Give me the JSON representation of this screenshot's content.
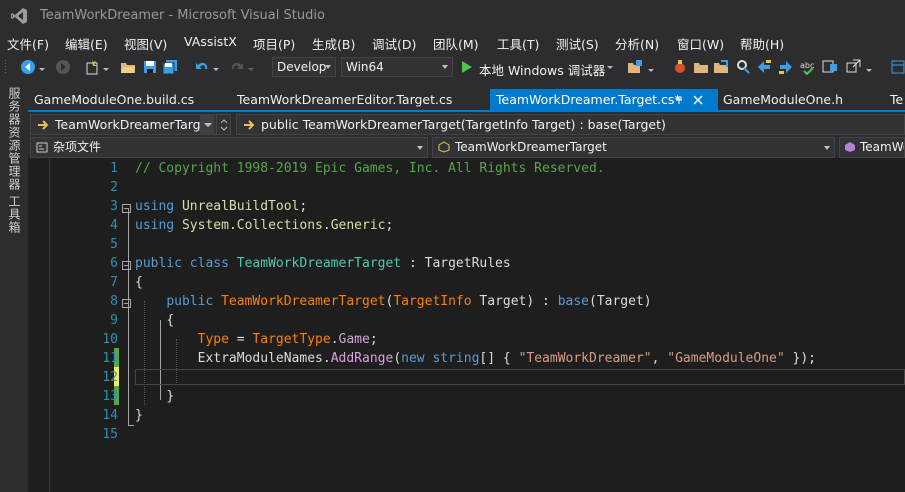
{
  "window": {
    "title": "TeamWorkDreamer - Microsoft Visual Studio"
  },
  "menu": [
    "文件(F)",
    "编辑(E)",
    "视图(V)",
    "VAssistX",
    "项目(P)",
    "生成(B)",
    "调试(D)",
    "团队(M)",
    "工具(T)",
    "测试(S)",
    "分析(N)",
    "窗口(W)",
    "帮助(H)"
  ],
  "toolbar": {
    "config_value": "Develop",
    "platform_value": "Win64",
    "run_label": "本地 Windows 调试器"
  },
  "side_panels": [
    "服务器资源管理器",
    "工具箱"
  ],
  "tabs": [
    {
      "label": "GameModuleOne.build.cs",
      "active": false
    },
    {
      "label": "TeamWorkDreamerEditor.Target.cs",
      "active": false
    },
    {
      "label": "TeamWorkDreamer.Target.cs*",
      "active": true
    },
    {
      "label": "GameModuleOne.h",
      "active": false
    },
    {
      "label": "Te",
      "active": false
    }
  ],
  "navigation": {
    "class_combo": "TeamWorkDreamerTarg",
    "member_combo": "public TeamWorkDreamerTarget(TargetInfo Target) : base(Target)",
    "project_combo": "杂项文件",
    "scope_combo": "TeamWorkDreamerTarget",
    "scope_combo2": "TeamWo"
  },
  "line_numbers": [
    "1",
    "2",
    "3",
    "4",
    "5",
    "6",
    "7",
    "8",
    "9",
    "10",
    "11",
    "12",
    "13",
    "14",
    "15"
  ],
  "code": {
    "l1": "// Copyright 1998-2019 Epic Games, Inc. All Rights Reserved.",
    "l3_kw": "using",
    "l3_ns": "UnrealBuildTool",
    "l3_end": ";",
    "l4_kw": "using",
    "l4_ns1": "System",
    "l4_ns2": "Collections",
    "l4_ns3": "Generic",
    "l4_end": ";",
    "l6_kw1": "public",
    "l6_kw2": "class",
    "l6_name": "TeamWorkDreamerTarget",
    "l6_rest": " : TargetRules",
    "l7": "{",
    "l8_kw": "public",
    "l8_name": "TeamWorkDreamerTarget",
    "l8_type": "TargetInfo",
    "l8_param": " Target) : ",
    "l8_base": "base",
    "l8_arg": "Target",
    "l9": "{",
    "l10_prop": "Type",
    "l10_eq": " = ",
    "l10_enum": "TargetType",
    "l10_val": "Game",
    "l11_obj": "ExtraModuleNames",
    "l11_m": "AddRange",
    "l11_new": "new",
    "l11_type": "string",
    "l11_s1": "\"TeamWorkDreamer\"",
    "l11_s2": "\"GameModuleOne\"",
    "l13": "}",
    "l14": "}"
  }
}
